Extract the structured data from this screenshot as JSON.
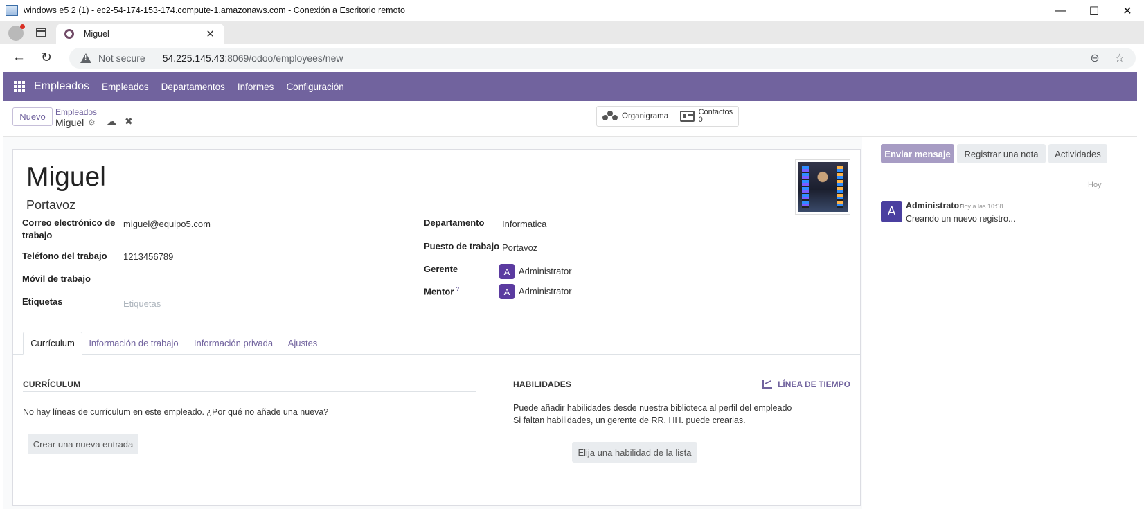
{
  "rdp": {
    "title": "windows e5 2 (1) - ec2-54-174-153-174.compute-1.amazonaws.com - Conexión a Escritorio remoto",
    "minimize": "—",
    "maximize": "☐",
    "close": "✕"
  },
  "browser": {
    "tab_title": "Miguel",
    "tab_close": "✕",
    "new_tab": "+",
    "not_secure": "Not secure",
    "url_host": "54.225.145.43",
    "url_rest": ":8069/odoo/employees/new",
    "back": "←",
    "reload": "↻",
    "zoom": "⊖",
    "star": "☆"
  },
  "odoo_nav": {
    "app_name": "Empleados",
    "menu": [
      "Empleados",
      "Departamentos",
      "Informes",
      "Configuración"
    ]
  },
  "control": {
    "new_button": "Nuevo",
    "breadcrumb_parent": "Empleados",
    "breadcrumb_current": "Miguel",
    "gear": "⚙",
    "save": "☁",
    "discard": "✖",
    "smart_buttons": {
      "org_chart": "Organigrama",
      "contacts_label": "Contactos",
      "contacts_count": "0"
    }
  },
  "employee": {
    "name": "Miguel",
    "job_title": "Portavoz"
  },
  "fields_left": {
    "work_email_label_1": "Correo electrónico de",
    "work_email_label_2": "trabajo",
    "work_email": "miguel@equipo5.com",
    "work_phone_label": "Teléfono del trabajo",
    "work_phone": "1213456789",
    "mobile_label": "Móvil de trabajo",
    "mobile": "",
    "tags_label": "Etiquetas",
    "tags_placeholder": "Etiquetas"
  },
  "fields_right": {
    "department_label": "Departamento",
    "department": "Informatica",
    "job_position_label": "Puesto de trabajo",
    "job_position": "Portavoz",
    "manager_label": "Gerente",
    "manager_initial": "A",
    "manager": "Administrator",
    "mentor_label": "Mentor",
    "mentor_help": "?",
    "mentor_initial": "A",
    "mentor": "Administrator"
  },
  "notebook": {
    "tabs": [
      "Currículum",
      "Información de trabajo",
      "Información privada",
      "Ajustes"
    ],
    "active": "Currículum"
  },
  "resume": {
    "title": "CURRÍCULUM",
    "empty_text": "No hay líneas de currículum en este empleado. ¿Por qué no añade una nueva?",
    "create_button": "Crear una nueva entrada"
  },
  "skills": {
    "title": "HABILIDADES",
    "timeline": "LÍNEA DE TIEMPO",
    "text_1": "Puede añadir habilidades desde nuestra biblioteca al perfil del empleado",
    "text_2": "Si faltan habilidades, un gerente de RR. HH. puede crearlas.",
    "pick_button": "Elija una habilidad de la lista"
  },
  "chatter": {
    "send_message": "Enviar mensaje",
    "log_note": "Registrar una nota",
    "activities": "Actividades",
    "today": "Hoy",
    "message": {
      "avatar": "A",
      "author": "Administrator",
      "time": "Hoy a las 10:58",
      "body": "Creando un nuevo registro..."
    }
  },
  "colors": {
    "brand": "#71639e",
    "avatar": "#5b3ba0",
    "primary_button_disabled": "#a79cc4"
  }
}
